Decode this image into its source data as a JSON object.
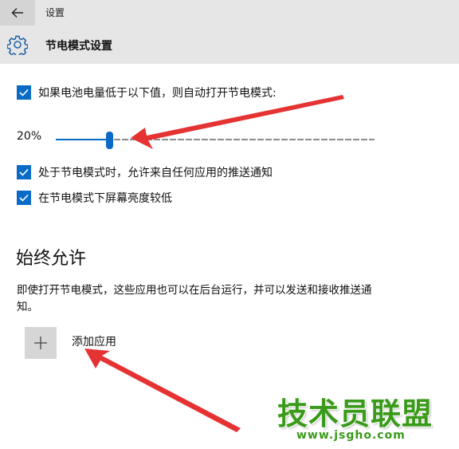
{
  "titlebar": {
    "title": "设置"
  },
  "header": {
    "title": "节电模式设置"
  },
  "settings": {
    "auto_saver": {
      "checked": true,
      "label": "如果电池电量低于以下值，则自动打开节电模式:"
    },
    "threshold": {
      "value_text": "20%",
      "value": 20
    },
    "push_notifications": {
      "checked": true,
      "label": "处于节电模式时，允许来自任何应用的推送通知"
    },
    "lower_brightness": {
      "checked": true,
      "label": "在节电模式下屏幕亮度较低"
    }
  },
  "always_allowed": {
    "title": "始终允许",
    "description": "即使打开节电模式，这些应用也可以在后台运行，并可以发送和接收推送通知。",
    "add_app_label": "添加应用"
  },
  "watermark": {
    "name": "技术员联盟",
    "url": "www.jsgho.com"
  },
  "colors": {
    "accent": "#0a6bc7",
    "annotation_arrow": "#e53232",
    "watermark": "#3a9a1a",
    "bar": "#e6e6e6"
  },
  "icons": {
    "back": "back-arrow-icon",
    "settings": "gear-icon",
    "checkbox": "checkmark-icon",
    "add": "plus-icon"
  }
}
